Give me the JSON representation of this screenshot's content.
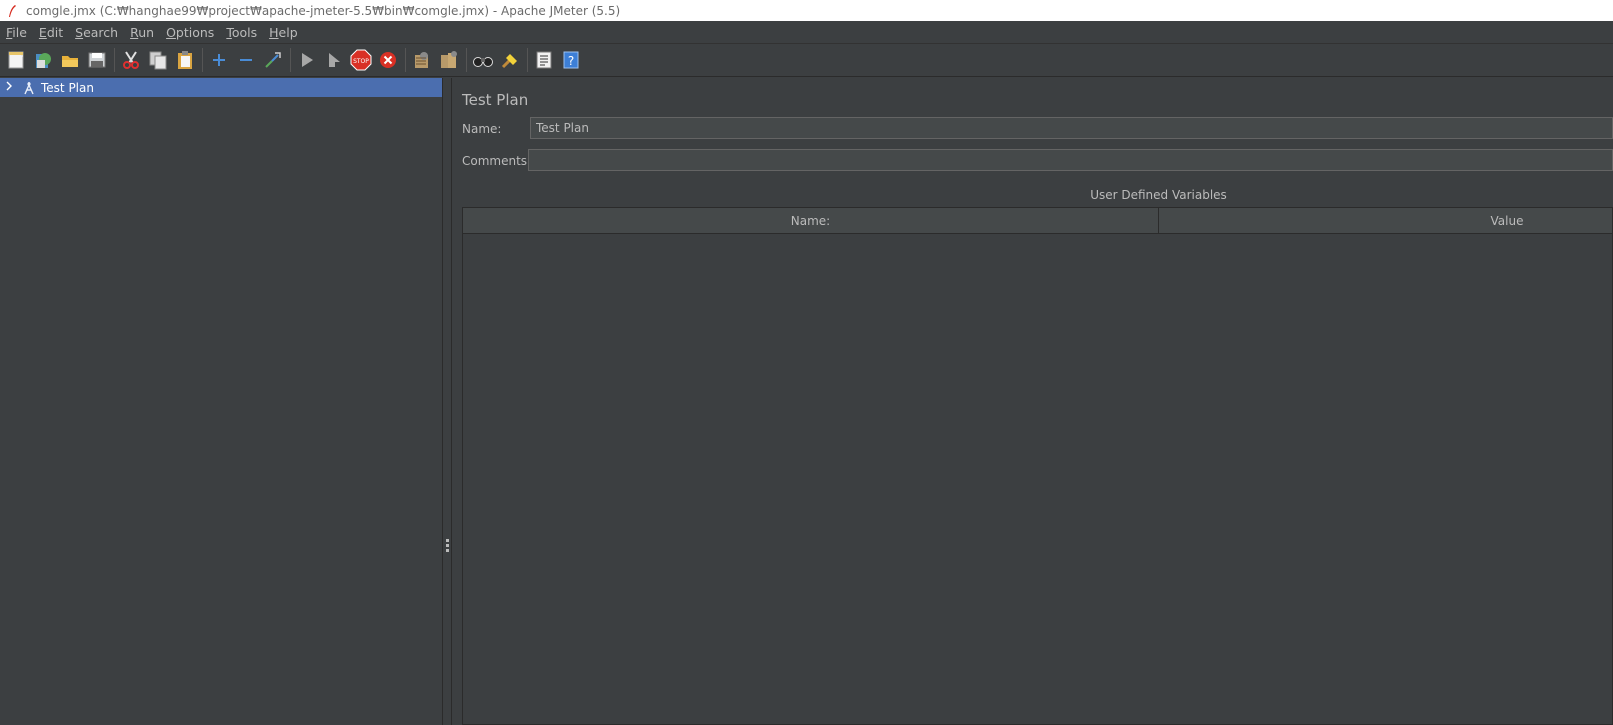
{
  "window": {
    "title": "comgle.jmx (C:₩hanghae99₩project₩apache-jmeter-5.5₩bin₩comgle.jmx) - Apache JMeter (5.5)"
  },
  "menu": [
    {
      "label": "File",
      "mnemonic": "F",
      "rest": "ile"
    },
    {
      "label": "Edit",
      "mnemonic": "E",
      "rest": "dit"
    },
    {
      "label": "Search",
      "mnemonic": "S",
      "rest": "earch"
    },
    {
      "label": "Run",
      "mnemonic": "R",
      "rest": "un"
    },
    {
      "label": "Options",
      "mnemonic": "O",
      "rest": "ptions"
    },
    {
      "label": "Tools",
      "mnemonic": "T",
      "rest": "ools"
    },
    {
      "label": "Help",
      "mnemonic": "H",
      "rest": "elp"
    }
  ],
  "toolbar": {
    "icons": [
      "new-icon",
      "templates-icon",
      "open-icon",
      "save-icon",
      "cut-icon",
      "copy-icon",
      "paste-icon",
      "expand-icon",
      "collapse-icon",
      "toggle-icon",
      "start-icon",
      "start-no-pause-icon",
      "stop-icon",
      "shutdown-icon",
      "clear-icon",
      "clear-all-icon",
      "search-icon",
      "reset-search-icon",
      "function-helper-icon",
      "help-icon"
    ]
  },
  "tree": {
    "items": [
      {
        "label": "Test Plan",
        "selected": true
      }
    ]
  },
  "main": {
    "title": "Test Plan",
    "name_label": "Name:",
    "name_value": "Test Plan",
    "comments_label": "Comments:",
    "comments_value": "",
    "variables_title": "User Defined Variables",
    "columns": [
      "Name:",
      "Value"
    ]
  },
  "colors": {
    "background": "#3c3f41",
    "selection": "#4b6eaf",
    "text": "#bbbbbb"
  }
}
